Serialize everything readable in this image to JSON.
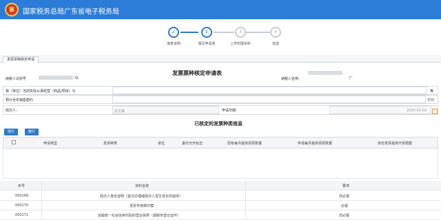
{
  "header": {
    "title": "国家税务总局广东省电子税务局"
  },
  "steps": [
    {
      "num": "✓",
      "label": "填表说明",
      "state": "done"
    },
    {
      "num": "2",
      "label": "填写申请表",
      "state": "active"
    },
    {
      "num": "3",
      "label": "上传附报资料",
      "state": "todo"
    },
    {
      "num": "4",
      "label": "完成",
      "state": "todo"
    }
  ],
  "tab": {
    "label": "发票票种核定申请"
  },
  "form": {
    "title": "发票票种核定申请表",
    "taxpayer_id_label": "纳税人识别号",
    "taxpayer_id_value_tail": "31",
    "taxpayer_name_label": "纳税人名称：",
    "taxpayer_name_value_tail": "厂",
    "business_label": "我（单位）当前实际从事经营（商品/项目）为",
    "business_suffix": "等",
    "annual_sales_label": "预计全年销售额约",
    "annual_sales_unit": "万元",
    "agent_label": "经办人：",
    "agent_value": "张文静",
    "apply_date_label": "申请日期：",
    "apply_date_value": "2020-02-03"
  },
  "approved": {
    "title": "已核定的发票种类信息",
    "add_button": "增行",
    "delete_button": "删行",
    "columns": [
      "申请类型",
      "发票种类",
      "单位",
      "委托代开标志",
      "原有每月最高领票数量",
      "申请每月最高领票数量",
      "单份发票最高开票限额"
    ]
  },
  "attachments": {
    "columns": [
      "序号",
      "资料名称",
      "要求"
    ],
    "rows": [
      {
        "id": "000169",
        "name": "经办人身份证明（首次办理或经办人发生变化时提供）",
        "req": "非必报"
      },
      {
        "id": "000170",
        "name": "发票专用章印模",
        "req": "必报"
      },
      {
        "id": "000171",
        "name": "加载统一社会信用代码的营业执照（或税务登记证件）",
        "req": "非必报"
      }
    ]
  }
}
